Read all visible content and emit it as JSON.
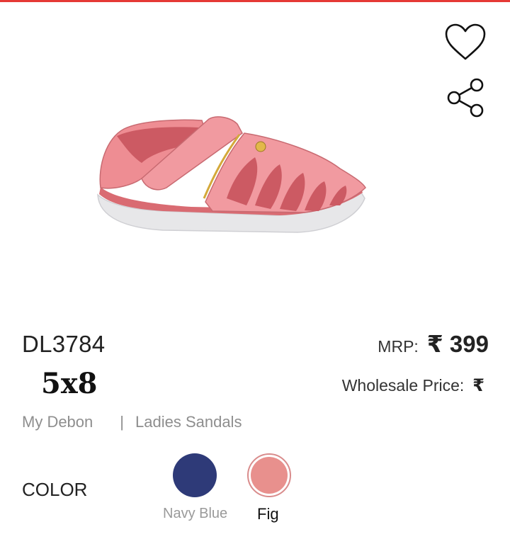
{
  "colors": {
    "accent": "#e53935",
    "navy_swatch": "#2e3a78",
    "fig_swatch": "#e8908d"
  },
  "product": {
    "image_icon": "pink-sandal-image",
    "sku": "DL3784",
    "size": "5x8",
    "brand": "My Debon",
    "separator": "|",
    "category": "Ladies Sandals"
  },
  "pricing": {
    "mrp_label": "MRP:",
    "mrp_value": "₹ 399",
    "wholesale_label": "Wholesale Price:",
    "wholesale_value": "₹"
  },
  "actions": {
    "wishlist_icon": "heart-icon",
    "share_icon": "share-icon"
  },
  "color_section": {
    "label": "COLOR",
    "options": [
      {
        "name": "Navy Blue",
        "hex": "#2e3a78",
        "selected": false
      },
      {
        "name": "Fig",
        "hex": "#e8908d",
        "selected": true
      }
    ]
  }
}
